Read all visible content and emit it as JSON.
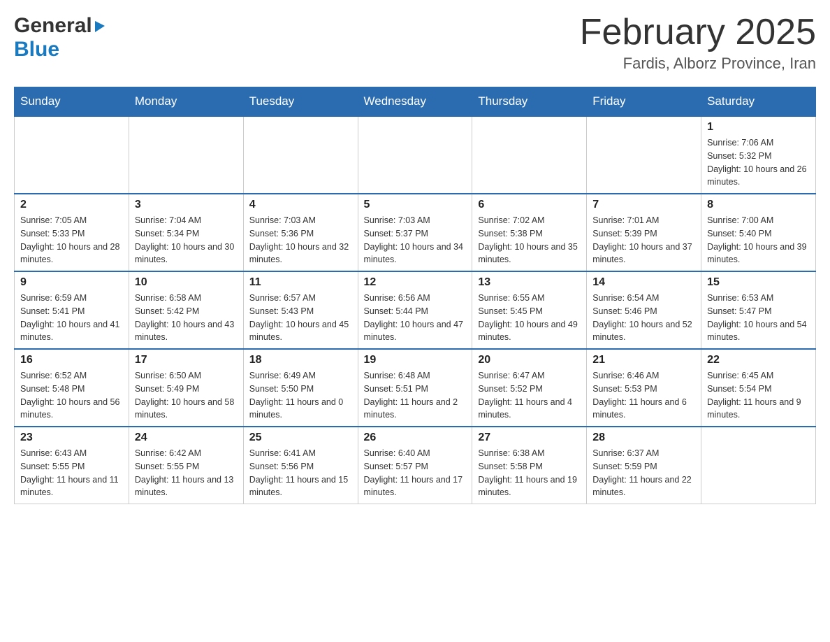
{
  "header": {
    "logo": {
      "general": "General",
      "blue": "Blue",
      "arrow": "▶"
    },
    "title": "February 2025",
    "location": "Fardis, Alborz Province, Iran"
  },
  "days_of_week": [
    "Sunday",
    "Monday",
    "Tuesday",
    "Wednesday",
    "Thursday",
    "Friday",
    "Saturday"
  ],
  "weeks": [
    [
      {
        "day": "",
        "info": ""
      },
      {
        "day": "",
        "info": ""
      },
      {
        "day": "",
        "info": ""
      },
      {
        "day": "",
        "info": ""
      },
      {
        "day": "",
        "info": ""
      },
      {
        "day": "",
        "info": ""
      },
      {
        "day": "1",
        "info": "Sunrise: 7:06 AM\nSunset: 5:32 PM\nDaylight: 10 hours and 26 minutes."
      }
    ],
    [
      {
        "day": "2",
        "info": "Sunrise: 7:05 AM\nSunset: 5:33 PM\nDaylight: 10 hours and 28 minutes."
      },
      {
        "day": "3",
        "info": "Sunrise: 7:04 AM\nSunset: 5:34 PM\nDaylight: 10 hours and 30 minutes."
      },
      {
        "day": "4",
        "info": "Sunrise: 7:03 AM\nSunset: 5:36 PM\nDaylight: 10 hours and 32 minutes."
      },
      {
        "day": "5",
        "info": "Sunrise: 7:03 AM\nSunset: 5:37 PM\nDaylight: 10 hours and 34 minutes."
      },
      {
        "day": "6",
        "info": "Sunrise: 7:02 AM\nSunset: 5:38 PM\nDaylight: 10 hours and 35 minutes."
      },
      {
        "day": "7",
        "info": "Sunrise: 7:01 AM\nSunset: 5:39 PM\nDaylight: 10 hours and 37 minutes."
      },
      {
        "day": "8",
        "info": "Sunrise: 7:00 AM\nSunset: 5:40 PM\nDaylight: 10 hours and 39 minutes."
      }
    ],
    [
      {
        "day": "9",
        "info": "Sunrise: 6:59 AM\nSunset: 5:41 PM\nDaylight: 10 hours and 41 minutes."
      },
      {
        "day": "10",
        "info": "Sunrise: 6:58 AM\nSunset: 5:42 PM\nDaylight: 10 hours and 43 minutes."
      },
      {
        "day": "11",
        "info": "Sunrise: 6:57 AM\nSunset: 5:43 PM\nDaylight: 10 hours and 45 minutes."
      },
      {
        "day": "12",
        "info": "Sunrise: 6:56 AM\nSunset: 5:44 PM\nDaylight: 10 hours and 47 minutes."
      },
      {
        "day": "13",
        "info": "Sunrise: 6:55 AM\nSunset: 5:45 PM\nDaylight: 10 hours and 49 minutes."
      },
      {
        "day": "14",
        "info": "Sunrise: 6:54 AM\nSunset: 5:46 PM\nDaylight: 10 hours and 52 minutes."
      },
      {
        "day": "15",
        "info": "Sunrise: 6:53 AM\nSunset: 5:47 PM\nDaylight: 10 hours and 54 minutes."
      }
    ],
    [
      {
        "day": "16",
        "info": "Sunrise: 6:52 AM\nSunset: 5:48 PM\nDaylight: 10 hours and 56 minutes."
      },
      {
        "day": "17",
        "info": "Sunrise: 6:50 AM\nSunset: 5:49 PM\nDaylight: 10 hours and 58 minutes."
      },
      {
        "day": "18",
        "info": "Sunrise: 6:49 AM\nSunset: 5:50 PM\nDaylight: 11 hours and 0 minutes."
      },
      {
        "day": "19",
        "info": "Sunrise: 6:48 AM\nSunset: 5:51 PM\nDaylight: 11 hours and 2 minutes."
      },
      {
        "day": "20",
        "info": "Sunrise: 6:47 AM\nSunset: 5:52 PM\nDaylight: 11 hours and 4 minutes."
      },
      {
        "day": "21",
        "info": "Sunrise: 6:46 AM\nSunset: 5:53 PM\nDaylight: 11 hours and 6 minutes."
      },
      {
        "day": "22",
        "info": "Sunrise: 6:45 AM\nSunset: 5:54 PM\nDaylight: 11 hours and 9 minutes."
      }
    ],
    [
      {
        "day": "23",
        "info": "Sunrise: 6:43 AM\nSunset: 5:55 PM\nDaylight: 11 hours and 11 minutes."
      },
      {
        "day": "24",
        "info": "Sunrise: 6:42 AM\nSunset: 5:55 PM\nDaylight: 11 hours and 13 minutes."
      },
      {
        "day": "25",
        "info": "Sunrise: 6:41 AM\nSunset: 5:56 PM\nDaylight: 11 hours and 15 minutes."
      },
      {
        "day": "26",
        "info": "Sunrise: 6:40 AM\nSunset: 5:57 PM\nDaylight: 11 hours and 17 minutes."
      },
      {
        "day": "27",
        "info": "Sunrise: 6:38 AM\nSunset: 5:58 PM\nDaylight: 11 hours and 19 minutes."
      },
      {
        "day": "28",
        "info": "Sunrise: 6:37 AM\nSunset: 5:59 PM\nDaylight: 11 hours and 22 minutes."
      },
      {
        "day": "",
        "info": ""
      }
    ]
  ]
}
